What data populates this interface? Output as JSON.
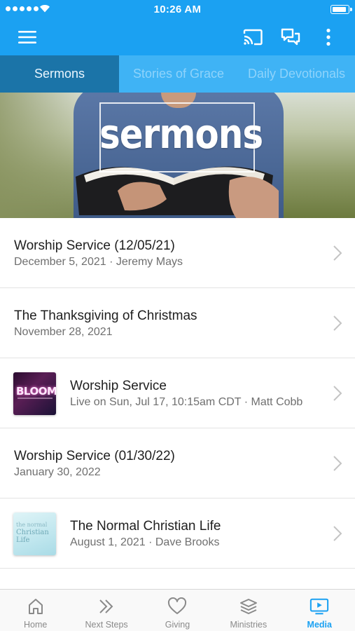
{
  "status_bar": {
    "time": "10:26 AM"
  },
  "app_bar": {
    "menu_icon": "hamburger-menu-icon",
    "cast_icon": "cast-icon",
    "chat_icon": "chat-bubbles-icon",
    "more_icon": "more-vertical-icon"
  },
  "tabs": [
    {
      "label": "Sermons",
      "active": true
    },
    {
      "label": "Stories of Grace",
      "active": false
    },
    {
      "label": "Daily Devotionals",
      "active": false
    }
  ],
  "hero": {
    "title": "sermons"
  },
  "items": [
    {
      "title": "Worship Service (12/05/21)",
      "subtitle": "December 5, 2021 · Jeremy Mays"
    },
    {
      "title": "The Thanksgiving of Christmas",
      "subtitle": "November 28, 2021"
    },
    {
      "title": "Worship Service",
      "subtitle": "Live on Sun, Jul 17, 10:15am CDT · Matt Cobb",
      "thumb_text": "BLOOM",
      "thumb_icon": "bloom-artwork-thumbnail"
    },
    {
      "title": "Worship Service (01/30/22)",
      "subtitle": "January 30, 2022"
    },
    {
      "title": "The Normal Christian Life",
      "subtitle": "August 1, 2021 · Dave Brooks",
      "thumb_text_1": "the normal",
      "thumb_text_2": "Christian Life",
      "thumb_icon": "normal-christian-life-thumbnail"
    }
  ],
  "tab_bar": [
    {
      "label": "Home",
      "icon": "home-icon",
      "active": false
    },
    {
      "label": "Next Steps",
      "icon": "double-chevron-icon",
      "active": false
    },
    {
      "label": "Giving",
      "icon": "heart-icon",
      "active": false
    },
    {
      "label": "Ministries",
      "icon": "layers-icon",
      "active": false
    },
    {
      "label": "Media",
      "icon": "media-play-icon",
      "active": true
    }
  ],
  "colors": {
    "primary": "#1ba1f2",
    "tab_active_bg": "#1b74a8",
    "tab_inactive_text": "#8ed3fb"
  }
}
